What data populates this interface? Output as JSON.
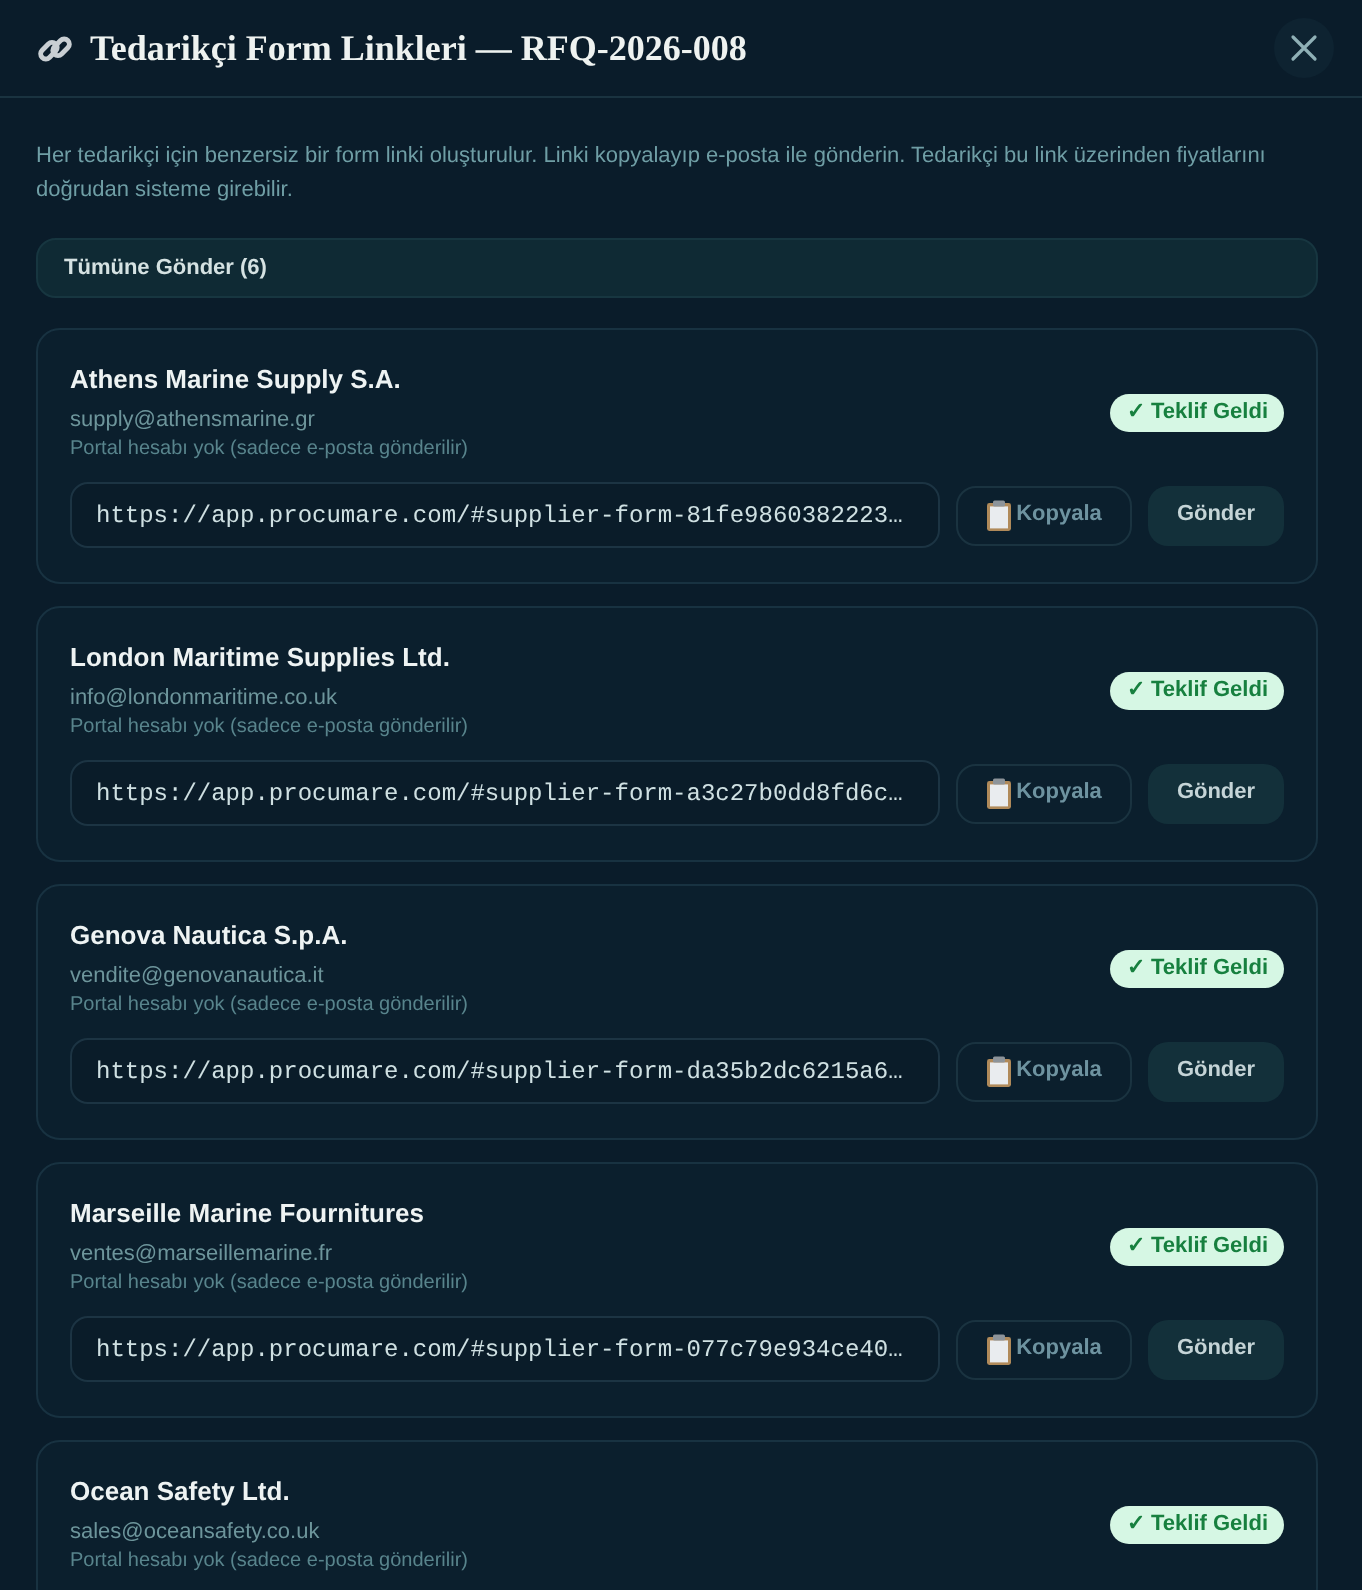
{
  "dialog": {
    "title": "Tedarikçi Form Linkleri — RFQ-2026-008"
  },
  "description": "Her tedarikçi için benzersiz bir form linki oluşturulur. Linki kopyalayıp e-posta ile gönderin. Tedarikçi bu link üzerinden fiyatlarını doğrudan sisteme girebilir.",
  "send_all_button": "Tümüne Gönder (6)",
  "suppliers": [
    {
      "name": "Athens Marine Supply S.A.",
      "email": "supply@athensmarine.gr",
      "note": "Portal hesabı yok (sadece e-posta gönderilir)",
      "status": "✓ Teklif Geldi",
      "link": "https://app.procumare.com/#supplier-form-81fe9860382223…",
      "copy_button": "Kopyala",
      "send_button": "Gönder"
    },
    {
      "name": "London Maritime Supplies Ltd.",
      "email": "info@londonmaritime.co.uk",
      "note": "Portal hesabı yok (sadece e-posta gönderilir)",
      "status": "✓ Teklif Geldi",
      "link": "https://app.procumare.com/#supplier-form-a3c27b0dd8fd6c…",
      "copy_button": "Kopyala",
      "send_button": "Gönder"
    },
    {
      "name": "Genova Nautica S.p.A.",
      "email": "vendite@genovanautica.it",
      "note": "Portal hesabı yok (sadece e-posta gönderilir)",
      "status": "✓ Teklif Geldi",
      "link": "https://app.procumare.com/#supplier-form-da35b2dc6215a6…",
      "copy_button": "Kopyala",
      "send_button": "Gönder"
    },
    {
      "name": "Marseille Marine Fournitures",
      "email": "ventes@marseillemarine.fr",
      "note": "Portal hesabı yok (sadece e-posta gönderilir)",
      "status": "✓ Teklif Geldi",
      "link": "https://app.procumare.com/#supplier-form-077c79e934ce40…",
      "copy_button": "Kopyala",
      "send_button": "Gönder"
    },
    {
      "name": "Ocean Safety Ltd.",
      "email": "sales@oceansafety.co.uk",
      "note": "Portal hesabı yok (sadece e-posta gönderilir)",
      "status": "✓ Teklif Geldi"
    }
  ]
}
